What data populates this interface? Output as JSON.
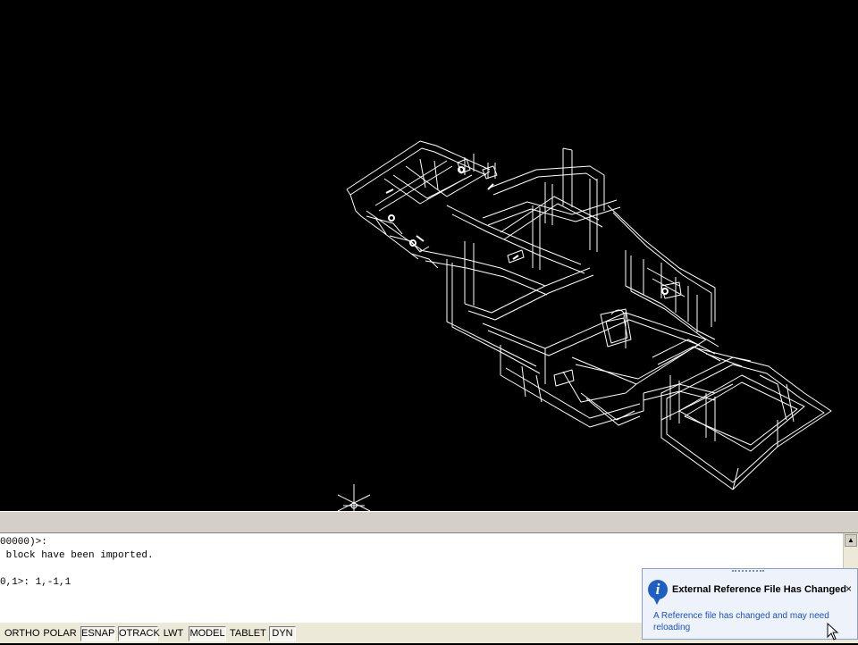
{
  "command_window": {
    "lines": [
      "00000)>:",
      " block have been imported.",
      "",
      "0,1>: 1,-1,1"
    ]
  },
  "status_bar": {
    "buttons": [
      {
        "label": "ORTHO",
        "on": false
      },
      {
        "label": "POLAR",
        "on": false
      },
      {
        "label": "ESNAP",
        "on": true
      },
      {
        "label": "OTRACK",
        "on": true
      },
      {
        "label": "LWT",
        "on": false
      },
      {
        "label": "MODEL",
        "on": true
      },
      {
        "label": "TABLET",
        "on": false
      },
      {
        "label": "DYN",
        "on": true
      }
    ]
  },
  "notification": {
    "title": "External Reference File Has Changed",
    "body": "A Reference file has changed and may need reloading",
    "close_label": "×",
    "icon_letter": "i"
  },
  "icons": {
    "ucs": "ucs-crosshair-icon",
    "info": "info-icon",
    "close": "close-icon",
    "cursor": "mouse-pointer-icon"
  }
}
